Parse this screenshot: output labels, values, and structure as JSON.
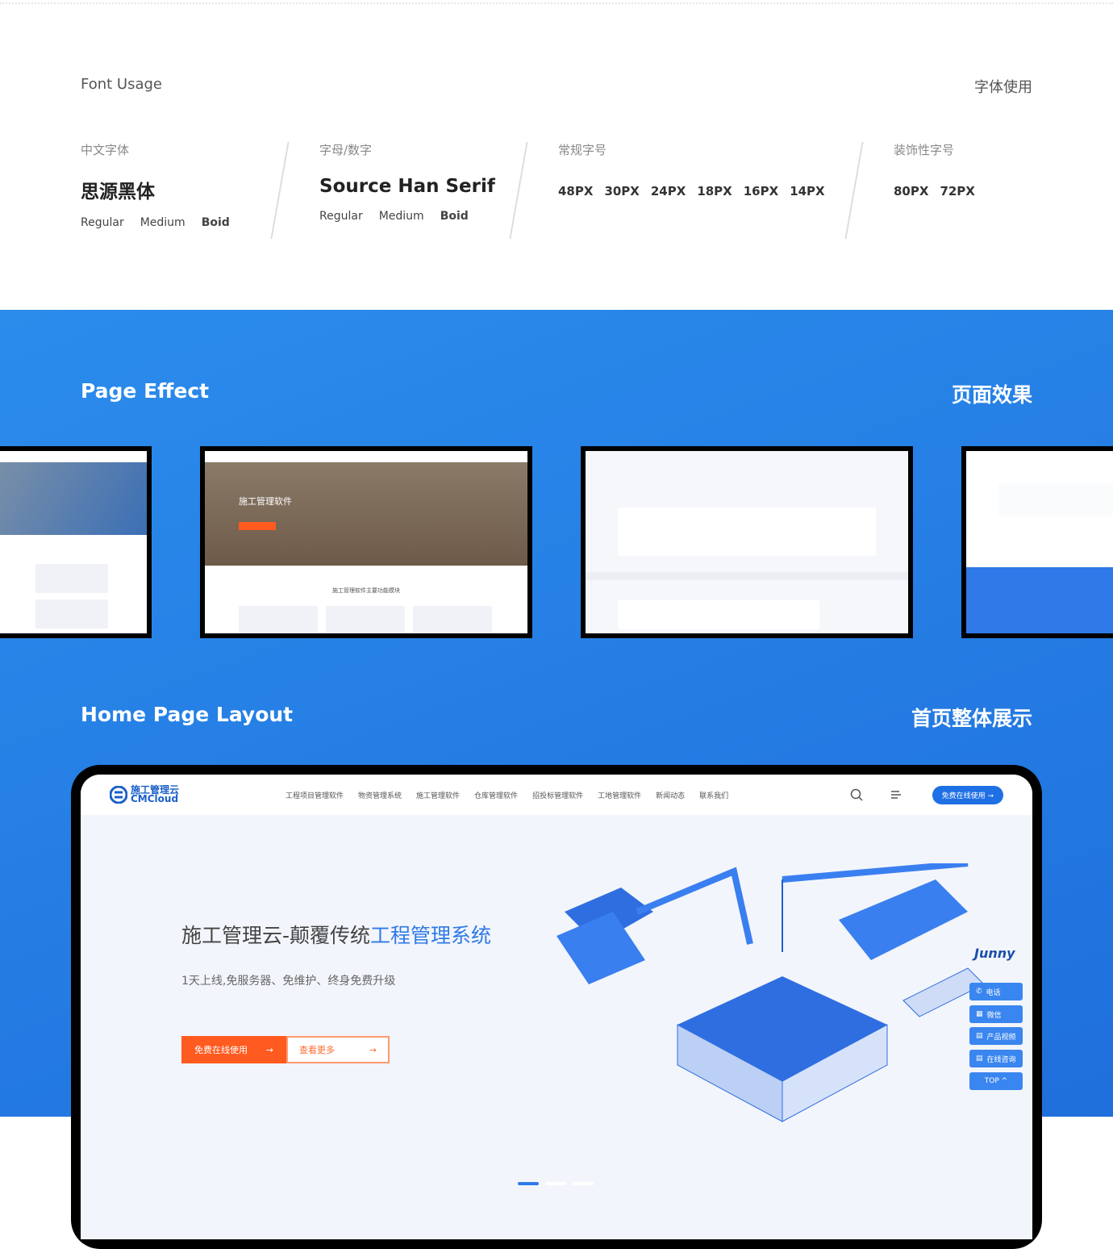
{
  "font_section": {
    "title_en": "Font Usage",
    "title_cn": "字体使用",
    "columns": [
      {
        "label": "中文字体",
        "name": "思源黑体",
        "weights": [
          "Regular",
          "Medium",
          "Boid"
        ]
      },
      {
        "label": "字母/数字",
        "name": "Source Han Serif",
        "weights": [
          "Regular",
          "Medium",
          "Boid"
        ]
      },
      {
        "label": "常规字号",
        "sizes": [
          "48PX",
          "30PX",
          "24PX",
          "18PX",
          "16PX",
          "14PX"
        ]
      },
      {
        "label": "装饰性字号",
        "sizes": [
          "80PX",
          "72PX"
        ]
      }
    ]
  },
  "page_effect": {
    "title_en": "Page Effect",
    "title_cn": "页面效果",
    "thumb_hero": "施工管理软件",
    "thumb_section": "施工管理软件主要功能模块"
  },
  "home_layout": {
    "title_en": "Home Page Layout",
    "title_cn": "首页整体展示"
  },
  "site": {
    "logo_cn": "施工管理云",
    "logo_en": "CMCloud",
    "menu": [
      "工程项目管理软件",
      "物资管理系统",
      "施工管理软件",
      "仓库管理软件",
      "招投标管理软件",
      "工地管理软件",
      "新闻动态",
      "联系我们"
    ],
    "try_button": "免费在线使用 →",
    "hero_title_a": "施工管理云-颠覆传统",
    "hero_title_b": "工程管理系统",
    "hero_sub": "1天上线,免服务器、免维护、终身免费升级",
    "primary_button": "免费在线使用",
    "secondary_button": "查看更多",
    "arrow": "→",
    "brand_logo": "Junny",
    "side_buttons": [
      "电话",
      "微信",
      "产品视频",
      "在线咨询",
      "TOP ^"
    ]
  },
  "colors": {
    "brand_blue": "#2b8cec",
    "accent_orange": "#ff5a1f"
  }
}
